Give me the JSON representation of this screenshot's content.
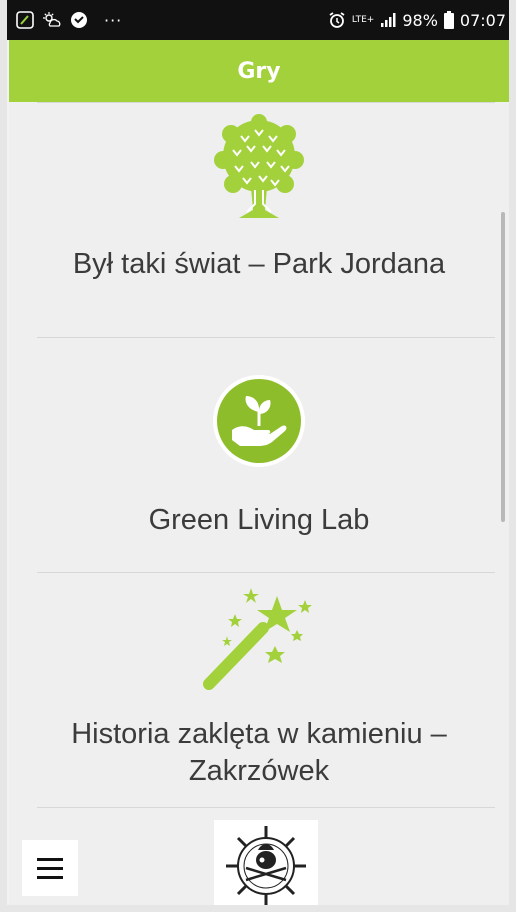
{
  "status_bar": {
    "network": "LTE+",
    "battery": "98%",
    "time": "07:07",
    "more": "···"
  },
  "app_bar": {
    "title": "Gry"
  },
  "games": [
    {
      "title": "Był taki świat – Park Jordana",
      "icon": "tree-icon"
    },
    {
      "title": "Green Living Lab",
      "icon": "plant-in-hand-icon"
    },
    {
      "title": "Historia zaklęta w kamieniu – Zakrzówek",
      "icon": "magic-wand-icon"
    },
    {
      "title": "",
      "icon": "pirate-emblem-icon"
    }
  ],
  "colors": {
    "accent": "#a2d13b",
    "status_bar": "#111111",
    "background": "#efefef",
    "text": "#3b3b3b"
  }
}
